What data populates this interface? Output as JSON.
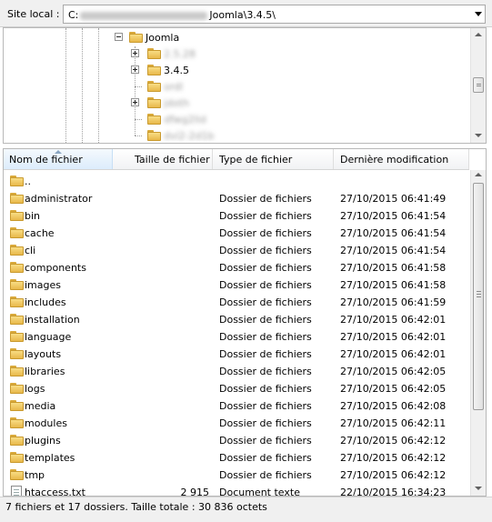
{
  "path_bar": {
    "label": "Site local :",
    "value_prefix": "C:",
    "value_suffix": "Joomla\\3.4.5\\"
  },
  "tree": {
    "items": [
      {
        "label": "Joomla",
        "expander": "minus"
      },
      {
        "label": "2.5.28",
        "expander": "plus",
        "obscured": true
      },
      {
        "label": "3.4.5",
        "expander": "plus",
        "obscured": false
      },
      {
        "label": "ordl",
        "expander": "none",
        "obscured": true
      },
      {
        "label": "jdoth",
        "expander": "plus",
        "obscured": true
      },
      {
        "label": "dfwg2lid",
        "expander": "none",
        "obscured": true
      },
      {
        "label": "dvi2-2d1b",
        "expander": "none",
        "obscured": true
      }
    ]
  },
  "file_list": {
    "columns": {
      "name": "Nom de fichier",
      "size": "Taille de fichier",
      "type": "Type de fichier",
      "modified": "Dernière modification"
    },
    "rows": [
      {
        "name": "..",
        "size": "",
        "type": "",
        "modified": "",
        "icon": "folder-icon"
      },
      {
        "name": "administrator",
        "size": "",
        "type": "Dossier de fichiers",
        "modified": "27/10/2015 06:41:49",
        "icon": "folder-icon"
      },
      {
        "name": "bin",
        "size": "",
        "type": "Dossier de fichiers",
        "modified": "27/10/2015 06:41:54",
        "icon": "folder-icon"
      },
      {
        "name": "cache",
        "size": "",
        "type": "Dossier de fichiers",
        "modified": "27/10/2015 06:41:54",
        "icon": "folder-icon"
      },
      {
        "name": "cli",
        "size": "",
        "type": "Dossier de fichiers",
        "modified": "27/10/2015 06:41:54",
        "icon": "folder-icon"
      },
      {
        "name": "components",
        "size": "",
        "type": "Dossier de fichiers",
        "modified": "27/10/2015 06:41:58",
        "icon": "folder-icon"
      },
      {
        "name": "images",
        "size": "",
        "type": "Dossier de fichiers",
        "modified": "27/10/2015 06:41:58",
        "icon": "folder-icon"
      },
      {
        "name": "includes",
        "size": "",
        "type": "Dossier de fichiers",
        "modified": "27/10/2015 06:41:59",
        "icon": "folder-icon"
      },
      {
        "name": "installation",
        "size": "",
        "type": "Dossier de fichiers",
        "modified": "27/10/2015 06:42:01",
        "icon": "folder-icon"
      },
      {
        "name": "language",
        "size": "",
        "type": "Dossier de fichiers",
        "modified": "27/10/2015 06:42:01",
        "icon": "folder-icon"
      },
      {
        "name": "layouts",
        "size": "",
        "type": "Dossier de fichiers",
        "modified": "27/10/2015 06:42:01",
        "icon": "folder-icon"
      },
      {
        "name": "libraries",
        "size": "",
        "type": "Dossier de fichiers",
        "modified": "27/10/2015 06:42:05",
        "icon": "folder-icon"
      },
      {
        "name": "logs",
        "size": "",
        "type": "Dossier de fichiers",
        "modified": "27/10/2015 06:42:05",
        "icon": "folder-icon"
      },
      {
        "name": "media",
        "size": "",
        "type": "Dossier de fichiers",
        "modified": "27/10/2015 06:42:08",
        "icon": "folder-icon"
      },
      {
        "name": "modules",
        "size": "",
        "type": "Dossier de fichiers",
        "modified": "27/10/2015 06:42:11",
        "icon": "folder-icon"
      },
      {
        "name": "plugins",
        "size": "",
        "type": "Dossier de fichiers",
        "modified": "27/10/2015 06:42:12",
        "icon": "folder-icon"
      },
      {
        "name": "templates",
        "size": "",
        "type": "Dossier de fichiers",
        "modified": "27/10/2015 06:42:12",
        "icon": "folder-icon"
      },
      {
        "name": "tmp",
        "size": "",
        "type": "Dossier de fichiers",
        "modified": "27/10/2015 06:42:12",
        "icon": "folder-icon"
      },
      {
        "name": "htaccess.txt",
        "size": "2 915",
        "type": "Document texte",
        "modified": "22/10/2015 16:34:23",
        "icon": "text-file-icon"
      }
    ]
  },
  "status_bar": {
    "text": "7 fichiers et 17 dossiers. Taille totale : 30 836 octets"
  },
  "colors": {
    "folder": "#f2c55c",
    "chrome": "#f0f0f0",
    "sorted_header": "#dcecfc"
  }
}
